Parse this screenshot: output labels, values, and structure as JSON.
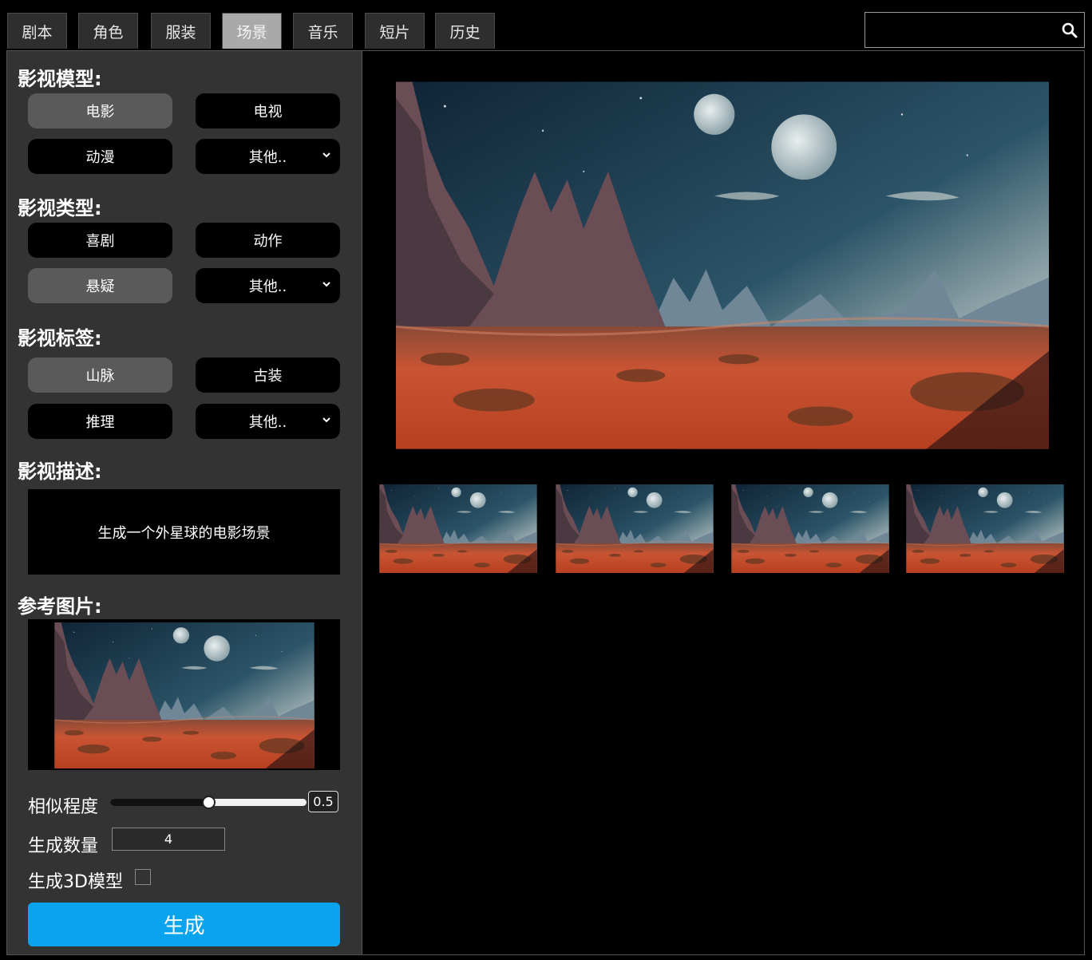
{
  "tabs": [
    {
      "label": "剧本",
      "active": false
    },
    {
      "label": "角色",
      "active": false
    },
    {
      "label": "服装",
      "active": false
    },
    {
      "label": "场景",
      "active": true
    },
    {
      "label": "音乐",
      "active": false
    },
    {
      "label": "短片",
      "active": false
    },
    {
      "label": "历史",
      "active": false
    }
  ],
  "search": {
    "value": "",
    "icon": "search-icon"
  },
  "sidebar": {
    "model_title": "影视模型:",
    "model_options": [
      "电影",
      "电视",
      "动漫",
      "其他.."
    ],
    "type_title": "影视类型:",
    "type_options": [
      "喜剧",
      "动作",
      "悬疑",
      "其他.."
    ],
    "tag_title": "影视标签:",
    "tag_options": [
      "山脉",
      "古装",
      "推理",
      "其他.."
    ],
    "desc_title": "影视描述:",
    "desc_text": "生成一个外星球的电影场景",
    "ref_title": "参考图片:",
    "similarity_label": "相似程度",
    "similarity_value": "0.5",
    "similarity_fraction": 0.5,
    "count_label": "生成数量",
    "count_value": "4",
    "model3d_label": "生成3D模型",
    "model3d_checked": false,
    "generate_label": "生成"
  },
  "colors": {
    "accent": "#0aa4ee",
    "selected_pill": "#5a5a5a",
    "panel": "#333333"
  }
}
